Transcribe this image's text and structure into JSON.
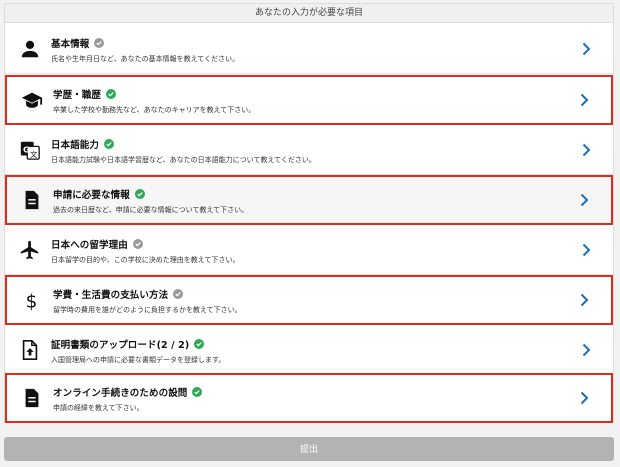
{
  "header": {
    "title": "あなたの入力が必要な項目"
  },
  "colors": {
    "check_green": "#2eaa57",
    "check_gray": "#9a9a9a",
    "chevron": "#1f6fb5",
    "highlight": "#e02b1a"
  },
  "items": [
    {
      "icon": "person-icon",
      "title": "基本情報",
      "status": "gray",
      "desc": "氏名や生年月日など、あなたの基本情報を教えてください。"
    },
    {
      "icon": "graduation-cap-icon",
      "title": "学歴・職歴",
      "status": "green",
      "desc": "卒業した学校や勤務先など、あなたのキャリアを教えて下さい。"
    },
    {
      "icon": "translate-icon",
      "title": "日本語能力",
      "status": "green",
      "desc": "日本語能力試験や日本語学習歴など、あなたの日本語能力について教えてください。"
    },
    {
      "icon": "document-icon",
      "title": "申請に必要な情報",
      "status": "green",
      "desc": "過去の来日歴など、申請に必要な情報について教えて下さい。"
    },
    {
      "icon": "airplane-icon",
      "title": "日本への留学理由",
      "status": "gray",
      "desc": "日本留学の目的や、この学校に決めた理由を教えて下さい。"
    },
    {
      "icon": "dollar-icon",
      "title": "学費・生活費の支払い方法",
      "status": "gray",
      "desc": "留学時の費用を誰がどのように負担するかを教えて下さい。"
    },
    {
      "icon": "upload-file-icon",
      "title": "証明書類のアップロード(2 / 2)",
      "status": "green",
      "desc": "入国管理局への申請に必要な書類データを登録します。"
    },
    {
      "icon": "document-icon",
      "title": "オンライン手続きのための設問",
      "status": "green",
      "desc": "申請の経緯を教えて下さい。"
    }
  ],
  "submit": {
    "label": "提出"
  }
}
